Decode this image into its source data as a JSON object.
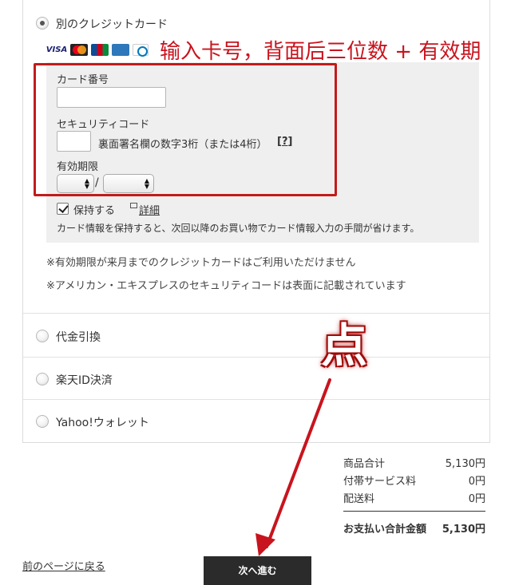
{
  "payment": {
    "card_option_label": "別のクレジットカード",
    "card_brands": [
      "VISA",
      "MasterCard",
      "JCB",
      "AMEX",
      "Diners"
    ],
    "card_number_label": "カード番号",
    "card_number_value": "",
    "security_code_label": "セキュリティコード",
    "security_code_value": "",
    "security_code_hint": "裏面署名欄の数字3桁（または4桁）",
    "help_open": "[",
    "help_mark": "?",
    "help_close": "]",
    "expiry_label": "有効期限",
    "expiry_month": "",
    "expiry_year": "",
    "expiry_separator": "/",
    "save_label": "保持する",
    "save_checked": true,
    "detail_link": "詳細",
    "save_note": "カード情報を保持すると、次回以降のお買い物でカード情報入力の手間が省けます。",
    "note_expiry": "※有効期限が来月までのクレジットカードはご利用いただけません",
    "note_amex": "※アメリカン・エキスプレスのセキュリティコードは表面に記載されています",
    "options": [
      {
        "label": "代金引換"
      },
      {
        "label": "楽天ID決済"
      },
      {
        "label": "Yahoo!ウォレット"
      }
    ]
  },
  "annotations": {
    "card_instruction": "输入卡号，背面后三位数 + 有效期",
    "click_marker": "点",
    "color": "#c8141e"
  },
  "summary": {
    "subtotal_label": "商品合计",
    "subtotal_value": "5,130円",
    "service_label": "付帯サービス料",
    "service_value": "0円",
    "shipping_label": "配送料",
    "shipping_value": "0円",
    "total_label": "お支払い合計金額",
    "total_value": "5,130円"
  },
  "footer": {
    "back_link": "前のページに戻る",
    "next_button": "次へ進む"
  }
}
